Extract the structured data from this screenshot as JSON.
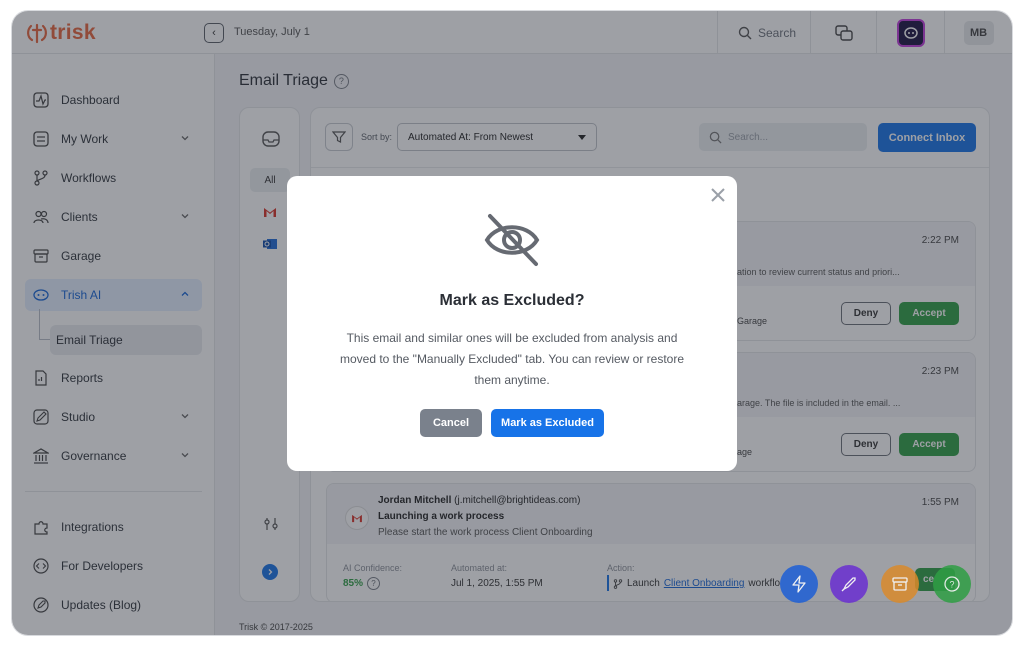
{
  "brand": {
    "name": "trisk",
    "color": "#e8643c"
  },
  "topbar": {
    "date": "Tuesday, July 1",
    "search_label": "Search",
    "avatar_initials": "MB"
  },
  "sidebar": {
    "items": [
      {
        "label": "Dashboard",
        "icon": "activity-icon"
      },
      {
        "label": "My Work",
        "icon": "checklist-icon",
        "expandable": true
      },
      {
        "label": "Workflows",
        "icon": "workflow-icon"
      },
      {
        "label": "Clients",
        "icon": "users-icon",
        "expandable": true
      },
      {
        "label": "Garage",
        "icon": "archive-icon"
      },
      {
        "label": "Trish AI",
        "icon": "ai-icon",
        "expandable": true,
        "active": true
      },
      {
        "label": "Reports",
        "icon": "report-icon"
      },
      {
        "label": "Studio",
        "icon": "pen-icon",
        "expandable": true
      },
      {
        "label": "Governance",
        "icon": "bank-icon",
        "expandable": true
      },
      {
        "label": "Integrations",
        "icon": "puzzle-icon"
      },
      {
        "label": "For Developers",
        "icon": "code-icon"
      },
      {
        "label": "Updates (Blog)",
        "icon": "rocket-icon"
      }
    ],
    "sub_item": "Email Triage"
  },
  "main": {
    "title": "Email Triage",
    "sources": {
      "all_label": "All"
    },
    "toolbar": {
      "sort_label": "Sort by:",
      "sort_value": "Automated At: From Newest",
      "search_placeholder": "Search...",
      "connect_label": "Connect Inbox"
    },
    "cards": [
      {
        "time": "2:22 PM",
        "snippet": "ation to review current status and priori...",
        "action_text": "Garage",
        "deny_label": "Deny",
        "accept_label": "Accept"
      },
      {
        "time": "2:23 PM",
        "snippet": "arage. The file is included in the email. ...",
        "action_text": "age",
        "deny_label": "Deny",
        "accept_label": "Accept"
      },
      {
        "sender_name": "Jordan Mitchell",
        "sender_email": "(j.mitchell@brightideas.com)",
        "subject": "Launching a work process",
        "preview": "Please start the work process Client Onboarding",
        "time": "1:55 PM",
        "confidence_label": "AI Confidence:",
        "confidence_value": "85%",
        "automated_label": "Automated at:",
        "automated_value": "Jul 1, 2025, 1:55 PM",
        "action_label": "Action:",
        "action_prefix": "Launch",
        "action_link": "Client Onboarding",
        "action_suffix": "workflo",
        "accept_partial": "ce"
      }
    ]
  },
  "footer": {
    "copyright": "Trisk © 2017-2025"
  },
  "modal": {
    "title": "Mark as Excluded?",
    "body": "This email and similar ones will be excluded from analysis and moved to the \"Manually Excluded\" tab. You can review or restore them anytime.",
    "cancel_label": "Cancel",
    "confirm_label": "Mark as Excluded"
  },
  "fabs": [
    {
      "icon": "bolt-icon",
      "color": "#1d5fd6"
    },
    {
      "icon": "rocket-icon",
      "color": "#6a2fd1"
    },
    {
      "icon": "archive-icon",
      "color": "#d98a2b"
    },
    {
      "icon": "help-icon",
      "color": "#2f9e44"
    }
  ],
  "colors": {
    "accent": "#1773e8",
    "success": "#2f9e44",
    "muted": "#7a818c"
  }
}
